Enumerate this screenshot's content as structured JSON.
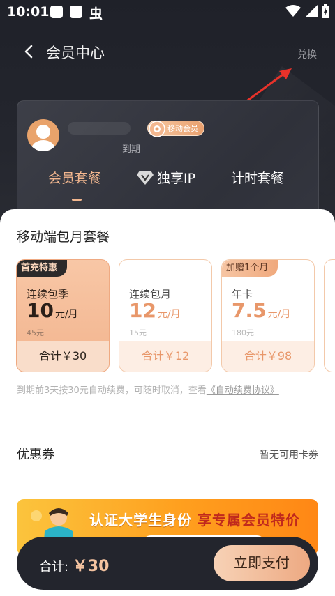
{
  "status_bar": {
    "time": "10:01",
    "glyph": "虫"
  },
  "header": {
    "title": "会员中心",
    "exchange_label": "兑换"
  },
  "member_card": {
    "badge_label": "移动会员",
    "expire_label": "到期",
    "tabs": [
      {
        "label": "会员套餐"
      },
      {
        "label": "独享IP"
      },
      {
        "label": "计时套餐"
      }
    ]
  },
  "plans_section": {
    "title": "移动端包月套餐",
    "plans": [
      {
        "tag": "首充特惠",
        "name": "连续包季",
        "price": "10",
        "unit": "元/月",
        "original": "45元",
        "total": "合计￥30"
      },
      {
        "tag": "",
        "name": "连续包月",
        "price": "12",
        "unit": "元/月",
        "original": "15元",
        "total": "合计￥12"
      },
      {
        "tag": "加赠1个月",
        "name": "年卡",
        "price": "7.5",
        "unit": "元/月",
        "original": "180元",
        "total": "合计￥98"
      }
    ],
    "note_text": "到期前3天按30元自动续费，可随时取消，查看",
    "agreement_link": "《自动续费协议》"
  },
  "coupon": {
    "label": "优惠券",
    "value": "暂无可用卡券"
  },
  "banner": {
    "text_prefix": "认证大学生身份 ",
    "text_highlight": "享专属会员特价"
  },
  "pay_bar": {
    "total_label": "合计: ",
    "total_amount": "￥30",
    "pay_button": "立即支付"
  },
  "colors": {
    "accent": "#f3b78f",
    "dark": "#23252d",
    "banner": "#ff9f1e"
  }
}
